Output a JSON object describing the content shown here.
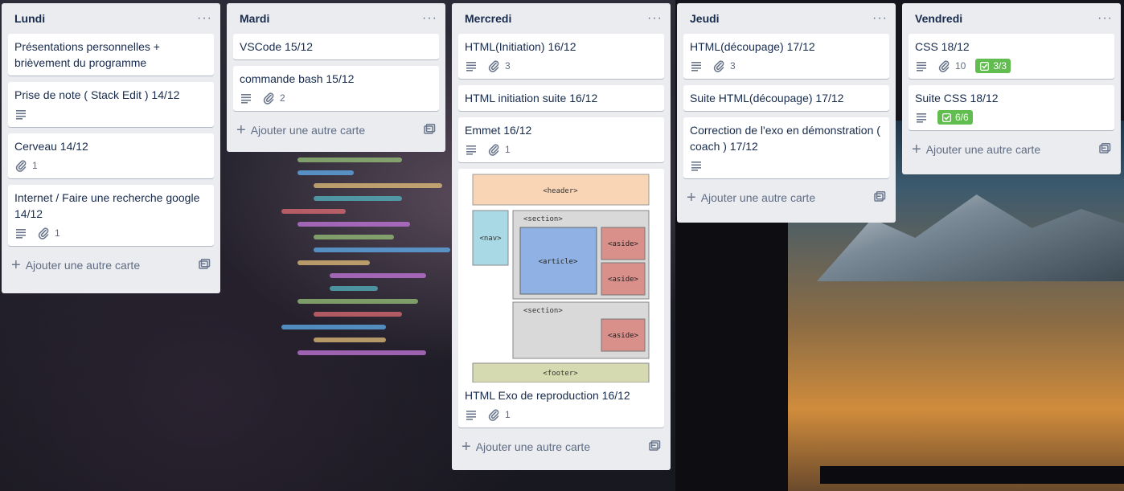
{
  "lists": [
    {
      "title": "Lundi",
      "cards": [
        {
          "title": "Présentations personnelles + brièvement du programme"
        },
        {
          "title": "Prise de note ( Stack Edit ) 14/12"
        },
        {
          "title": "Cerveau 14/12",
          "attachments": "1"
        },
        {
          "title": "Internet / Faire une recherche google 14/12",
          "attachments": "1"
        }
      ],
      "add_label": "Ajouter une autre carte"
    },
    {
      "title": "Mardi",
      "cards": [
        {
          "title": "VSCode 15/12"
        },
        {
          "title": "commande bash 15/12",
          "attachments": "2"
        }
      ],
      "add_label": "Ajouter une autre carte"
    },
    {
      "title": "Mercredi",
      "cards": [
        {
          "title": "HTML(Initiation) 16/12",
          "attachments": "3"
        },
        {
          "title": "HTML initiation suite 16/12"
        },
        {
          "title": "Emmet 16/12",
          "attachments": "1"
        },
        {
          "title": "HTML Exo de reproduction 16/12",
          "attachments": "1"
        }
      ],
      "cover_labels": {
        "header": "<header>",
        "nav": "<nav>",
        "section1": "<section>",
        "article": "<article>",
        "aside1": "<aside>",
        "aside2": "<aside>",
        "section2": "<section>",
        "aside3": "<aside>",
        "footer": "<footer>"
      },
      "add_label": "Ajouter une autre carte"
    },
    {
      "title": "Jeudi",
      "cards": [
        {
          "title": "HTML(découpage) 17/12",
          "attachments": "3"
        },
        {
          "title": "Suite HTML(découpage) 17/12"
        },
        {
          "title": "Correction de l'exo en démonstration ( coach ) 17/12"
        }
      ],
      "add_label": "Ajouter une autre carte"
    },
    {
      "title": "Vendredi",
      "cards": [
        {
          "title": "CSS 18/12",
          "attachments": "10",
          "checklist": "3/3"
        },
        {
          "title": "Suite CSS 18/12",
          "checklist": "6/6"
        }
      ],
      "add_label": "Ajouter une autre carte"
    }
  ],
  "menu_glyph": "···",
  "colors": {
    "list_bg": "#ebecf0",
    "card_bg": "#ffffff",
    "checklist_complete": "#61bd4f",
    "muted_text": "#5e6c84"
  },
  "icons": [
    "description-icon",
    "attachment-icon",
    "checklist-icon",
    "plus-icon",
    "template-icon",
    "more-icon"
  ]
}
